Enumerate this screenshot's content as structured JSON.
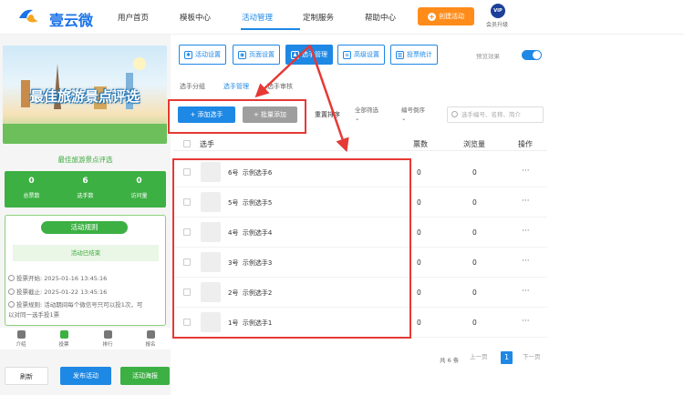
{
  "brand": {
    "name": "壹云微"
  },
  "nav": {
    "items": [
      "用户首页",
      "模板中心",
      "活动管理",
      "定制服务",
      "帮助中心"
    ],
    "active_index": 2
  },
  "header": {
    "create_label": "创建活动",
    "vip_badge": "VIP",
    "vip_label": "会员升级"
  },
  "preview": {
    "banner_title": "最佳旅游景点评选",
    "subtitle": "最佳旅游景点评选",
    "stats": [
      {
        "value": "0",
        "label": "总票数"
      },
      {
        "value": "6",
        "label": "选手数"
      },
      {
        "value": "0",
        "label": "访问量"
      }
    ],
    "rules_title": "活动规则",
    "status": "活动已结束",
    "rules": [
      {
        "label": "投票开始:",
        "value": "2025-01-16 13:45:16"
      },
      {
        "label": "投票截止:",
        "value": "2025-01-22 13:45:16"
      },
      {
        "label": "投票规则:",
        "value": "活动期间每个微信号只可以投1次，可以对同一选手投1票"
      }
    ],
    "tabbar": [
      "介绍",
      "投票",
      "排行",
      "报名"
    ]
  },
  "bottom_buttons": {
    "refresh": "刷新",
    "publish": "发布活动",
    "poster": "活动海报"
  },
  "toolbar": {
    "tabs": [
      "活动设置",
      "页面设置",
      "选手管理",
      "高级设置",
      "投票统计"
    ],
    "active_index": 2,
    "preview_label": "预览效果",
    "preview_on": true
  },
  "subtabs": {
    "items": [
      "选手分组",
      "选手管理",
      "选手审核"
    ],
    "active_index": 1
  },
  "actions": {
    "add": "+ 添加选手",
    "batch": "+ 批量添加",
    "reset": "重置排序",
    "filter": "全部筛选",
    "sort": "编号倒序",
    "search_placeholder": "选手编号、名称、简介"
  },
  "table": {
    "headers": [
      "选手",
      "票数",
      "浏览量",
      "操作"
    ],
    "rows": [
      {
        "no": "6号",
        "name": "示例选手6",
        "votes": "0",
        "views": "0",
        "op": "···"
      },
      {
        "no": "5号",
        "name": "示例选手5",
        "votes": "0",
        "views": "0",
        "op": "···"
      },
      {
        "no": "4号",
        "name": "示例选手4",
        "votes": "0",
        "views": "0",
        "op": "···"
      },
      {
        "no": "3号",
        "name": "示例选手3",
        "votes": "0",
        "views": "0",
        "op": "···"
      },
      {
        "no": "2号",
        "name": "示例选手2",
        "votes": "0",
        "views": "0",
        "op": "···"
      },
      {
        "no": "1号",
        "name": "示例选手1",
        "votes": "0",
        "views": "0",
        "op": "···"
      }
    ]
  },
  "pagination": {
    "total": "共 6 条",
    "prev": "上一页",
    "current": "1",
    "next": "下一页"
  },
  "colors": {
    "primary": "#1e88e5",
    "green": "#3cb043",
    "orange": "#ff8c1a",
    "highlight": "#e53935"
  }
}
